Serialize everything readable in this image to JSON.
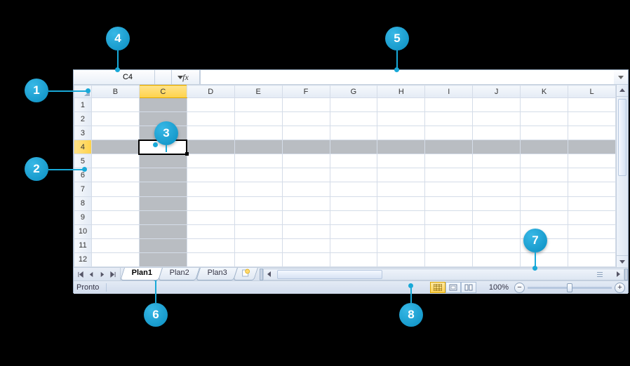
{
  "name_box": {
    "value": "C4"
  },
  "formula_bar": {
    "fx_label": "fx",
    "value": ""
  },
  "columns": [
    "B",
    "C",
    "D",
    "E",
    "F",
    "G",
    "H",
    "I",
    "J",
    "K",
    "L"
  ],
  "rows": [
    "1",
    "2",
    "3",
    "4",
    "5",
    "6",
    "7",
    "8",
    "9",
    "10",
    "11",
    "12"
  ],
  "highlight": {
    "col": "C",
    "row": "4",
    "active": "C4"
  },
  "sheet_tabs": {
    "tabs": [
      "Plan1",
      "Plan2",
      "Plan3"
    ],
    "active": "Plan1",
    "new_icon": "insert-sheet-icon"
  },
  "status": {
    "text": "Pronto"
  },
  "view_modes": [
    "normal",
    "page-layout",
    "page-break"
  ],
  "zoom": {
    "label": "100%",
    "value": 100,
    "min": 10,
    "max": 400
  },
  "callouts": {
    "1": "1",
    "2": "2",
    "3": "3",
    "4": "4",
    "5": "5",
    "6": "6",
    "7": "7",
    "8": "8"
  }
}
